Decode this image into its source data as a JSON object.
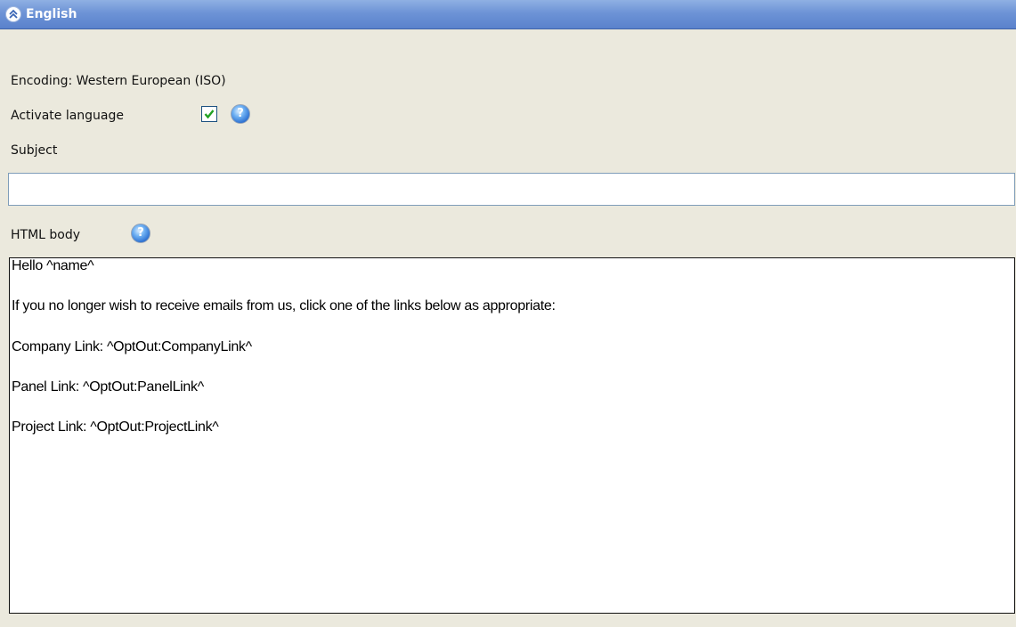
{
  "header": {
    "title": "English",
    "collapse_icon": "chevron-double-up-icon"
  },
  "encoding": {
    "text": "Encoding: Western European (ISO)"
  },
  "activate": {
    "label": "Activate language",
    "checked": true,
    "help_icon": "help-icon"
  },
  "subject": {
    "label": "Subject",
    "value": ""
  },
  "html_body": {
    "label": "HTML body",
    "help_icon": "help-icon",
    "lines": [
      "Hello ^name^",
      "If you no longer wish to receive emails from us, click one of the links below as appropriate:",
      "Company Link: ^OptOut:CompanyLink^",
      "Panel Link: ^OptOut:PanelLink^",
      "Project Link: ^OptOut:ProjectLink^"
    ]
  },
  "colors": {
    "header_gradient_top": "#8fb0e3",
    "header_gradient_bottom": "#5a82cc",
    "background": "#ebe9dd",
    "checkbox_check": "#21a121"
  }
}
